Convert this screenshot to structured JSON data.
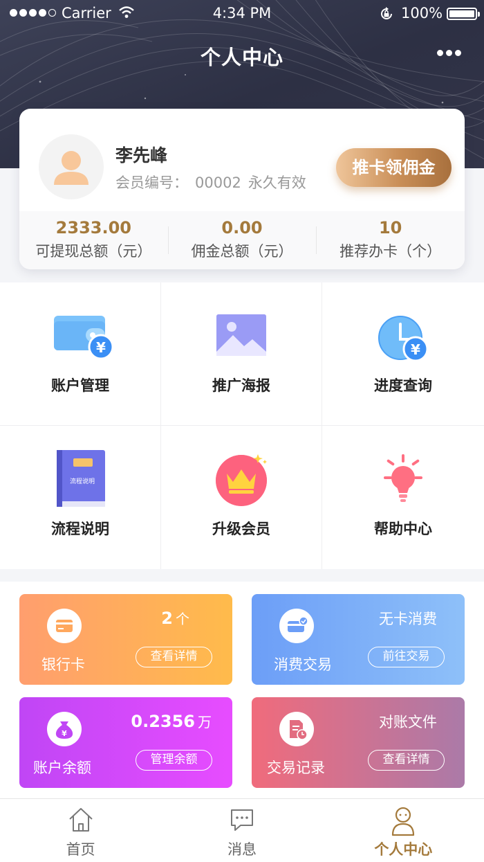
{
  "status_bar": {
    "carrier": "Carrier",
    "time": "4:34 PM",
    "battery": "100%"
  },
  "header": {
    "title": "个人中心"
  },
  "profile": {
    "name": "李先峰",
    "member_label": "会员编号：",
    "member_id": "00002",
    "validity": "永久有效",
    "action_label": "推卡领佣金"
  },
  "stats": [
    {
      "value": "2333.00",
      "label": "可提现总额（元）"
    },
    {
      "value": "0.00",
      "label": "佣金总额（元）"
    },
    {
      "value": "10",
      "label": "推荐办卡（个）"
    }
  ],
  "menu": [
    {
      "label": "账户管理",
      "icon": "wallet-icon"
    },
    {
      "label": "推广海报",
      "icon": "poster-icon"
    },
    {
      "label": "进度查询",
      "icon": "clock-yen-icon"
    },
    {
      "label": "流程说明",
      "icon": "book-icon"
    },
    {
      "label": "升级会员",
      "icon": "crown-icon"
    },
    {
      "label": "帮助中心",
      "icon": "lightbulb-icon"
    }
  ],
  "book_icon_text": "流程说明",
  "cards": {
    "bank": {
      "name": "银行卡",
      "value": "2",
      "unit": "个",
      "button": "查看详情",
      "icon": "card-icon"
    },
    "consume": {
      "name": "消费交易",
      "value": "无卡消费",
      "button": "前往交易",
      "icon": "payment-card-icon"
    },
    "balance": {
      "name": "账户余额",
      "value": "0.2356",
      "unit": "万",
      "button": "管理余额",
      "icon": "money-bag-icon"
    },
    "records": {
      "name": "交易记录",
      "value": "对账文件",
      "button": "查看详情",
      "icon": "document-clock-icon"
    }
  },
  "tabs": [
    {
      "label": "首页",
      "icon": "home-icon"
    },
    {
      "label": "消息",
      "icon": "message-icon"
    },
    {
      "label": "个人中心",
      "icon": "user-icon",
      "active": true
    }
  ],
  "colors": {
    "accent_gold": "#a47a3c",
    "header_bg": "#2d3044",
    "bank_card": "#ffa85e",
    "consume_card": "#7aaef8",
    "balance_card": "#d24bfa",
    "records_card": "#d0738f"
  }
}
